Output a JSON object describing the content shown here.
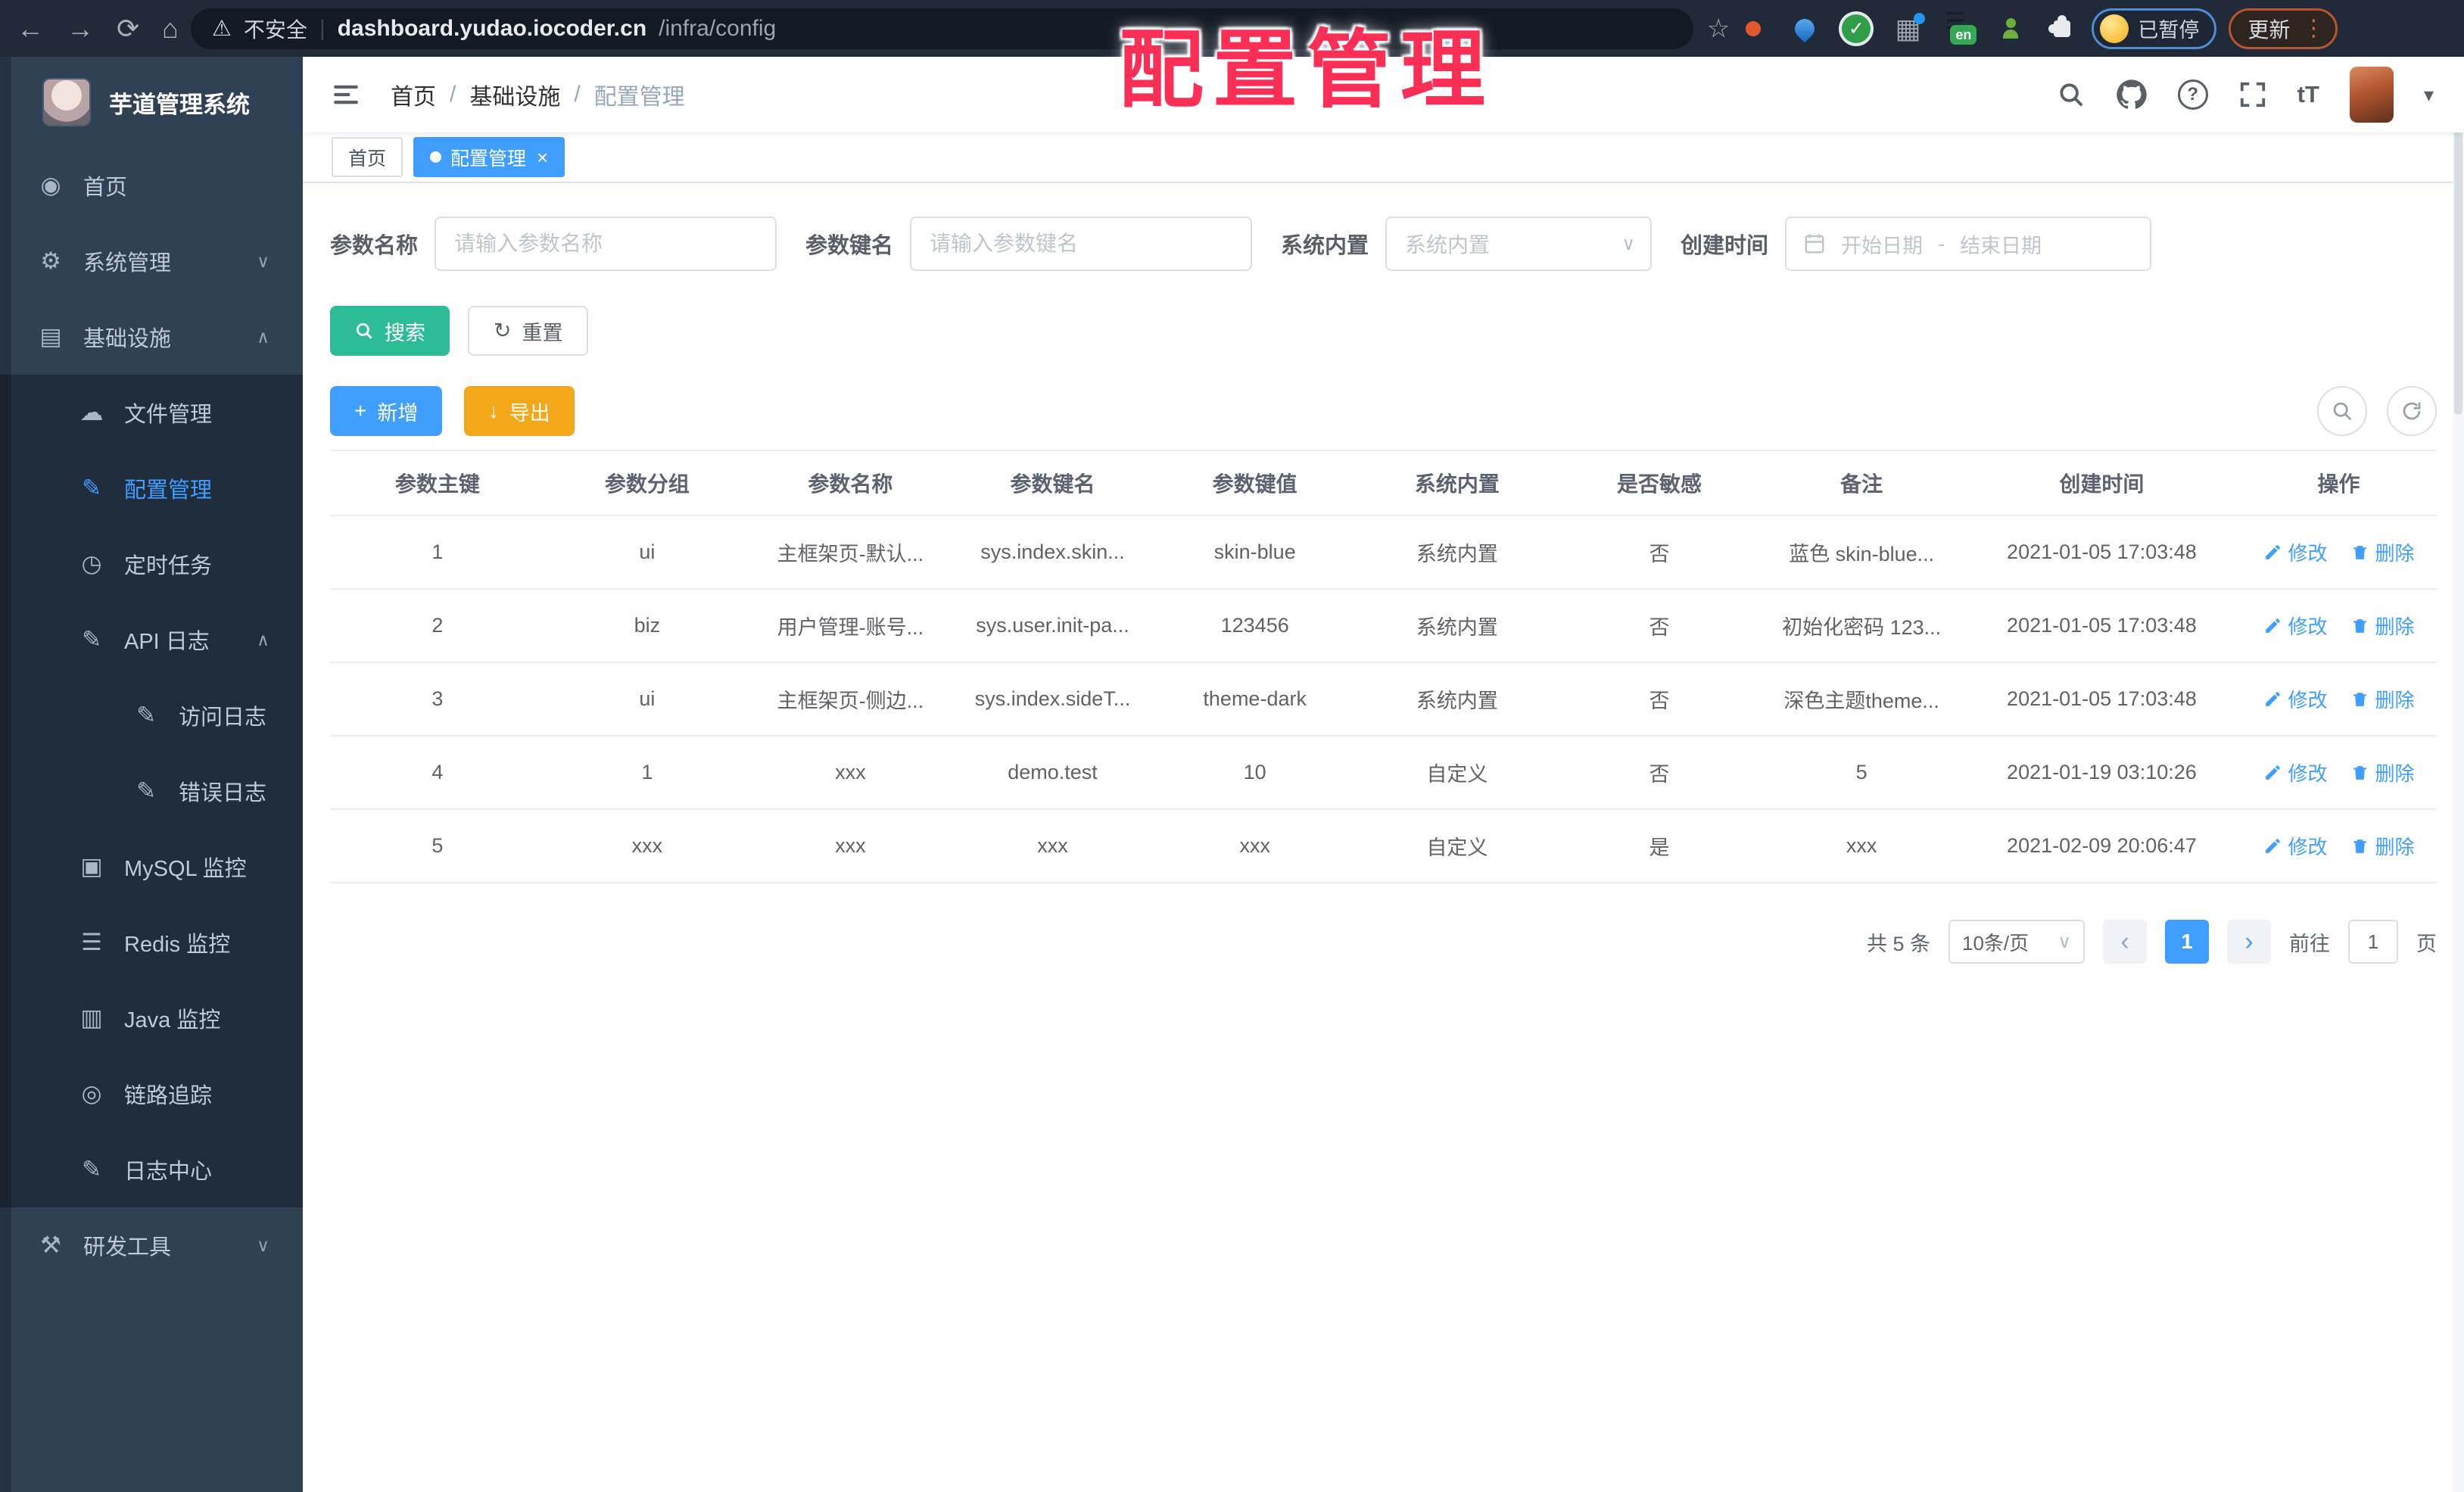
{
  "browser": {
    "security_label": "不安全",
    "url_host": "dashboard.yudao.iocoder.cn",
    "url_path": "/infra/config",
    "paused_label": "已暂停",
    "update_label": "更新"
  },
  "overlay_title": "配置管理",
  "icons": {
    "back": "←",
    "forward": "→",
    "reload": "⟳",
    "home": "⌂",
    "warning": "⚠",
    "star": "☆",
    "menu_dots": "⋮",
    "check": "✓",
    "grid": "▦",
    "stack_dark": "☰",
    "translate_badge": "en",
    "question": "?",
    "font_size": "tT",
    "close": "×",
    "select_caret": "∨",
    "user_caret": "▾",
    "divider": "|",
    "refresh": "↻",
    "plus": "+",
    "download": "↓",
    "prev": "‹",
    "next": "›",
    "range_sep": "-"
  },
  "sidebar": {
    "app_title": "芋道管理系统",
    "items": [
      {
        "label": "首页",
        "icon": "◉"
      },
      {
        "label": "系统管理",
        "icon": "⚙",
        "chevron": "∨"
      },
      {
        "label": "基础设施",
        "icon": "▤",
        "chevron": "∧"
      },
      {
        "label": "文件管理",
        "icon": "☁"
      },
      {
        "label": "配置管理",
        "icon": "✎"
      },
      {
        "label": "定时任务",
        "icon": "◷"
      },
      {
        "label": "API 日志",
        "icon": "✎",
        "chevron": "∧"
      },
      {
        "label": "访问日志",
        "icon": "✎"
      },
      {
        "label": "错误日志",
        "icon": "✎"
      },
      {
        "label": "MySQL 监控",
        "icon": "▣"
      },
      {
        "label": "Redis 监控",
        "icon": "☰"
      },
      {
        "label": "Java 监控",
        "icon": "▥"
      },
      {
        "label": "链路追踪",
        "icon": "◎"
      },
      {
        "label": "日志中心",
        "icon": "✎"
      },
      {
        "label": "研发工具",
        "icon": "⚒",
        "chevron": "∨"
      }
    ]
  },
  "header": {
    "breadcrumb": [
      "首页",
      "基础设施",
      "配置管理"
    ],
    "separator": "/"
  },
  "tags": {
    "home": "首页",
    "active": "配置管理"
  },
  "filters": {
    "name_label": "参数名称",
    "name_placeholder": "请输入参数名称",
    "key_label": "参数键名",
    "key_placeholder": "请输入参数键名",
    "type_label": "系统内置",
    "type_placeholder": "系统内置",
    "date_label": "创建时间",
    "date_start": "开始日期",
    "date_end": "结束日期"
  },
  "buttons": {
    "search": "搜索",
    "reset": "重置",
    "add": "新增",
    "export": "导出"
  },
  "table": {
    "columns": [
      "参数主键",
      "参数分组",
      "参数名称",
      "参数键名",
      "参数键值",
      "系统内置",
      "是否敏感",
      "备注",
      "创建时间",
      "操作"
    ],
    "ops": {
      "edit": "修改",
      "del": "删除"
    },
    "rows": [
      {
        "id": "1",
        "group": "ui",
        "name": "主框架页-默认...",
        "key": "sys.index.skin...",
        "value": "skin-blue",
        "type": "系统内置",
        "sensitive": "否",
        "remark": "蓝色 skin-blue...",
        "created": "2021-01-05 17:03:48"
      },
      {
        "id": "2",
        "group": "biz",
        "name": "用户管理-账号...",
        "key": "sys.user.init-pa...",
        "value": "123456",
        "type": "系统内置",
        "sensitive": "否",
        "remark": "初始化密码 123...",
        "created": "2021-01-05 17:03:48"
      },
      {
        "id": "3",
        "group": "ui",
        "name": "主框架页-侧边...",
        "key": "sys.index.sideT...",
        "value": "theme-dark",
        "type": "系统内置",
        "sensitive": "否",
        "remark": "深色主题theme...",
        "created": "2021-01-05 17:03:48"
      },
      {
        "id": "4",
        "group": "1",
        "name": "xxx",
        "key": "demo.test",
        "value": "10",
        "type": "自定义",
        "sensitive": "否",
        "remark": "5",
        "created": "2021-01-19 03:10:26"
      },
      {
        "id": "5",
        "group": "xxx",
        "name": "xxx",
        "key": "xxx",
        "value": "xxx",
        "type": "自定义",
        "sensitive": "是",
        "remark": "xxx",
        "created": "2021-02-09 20:06:47"
      }
    ]
  },
  "pagination": {
    "total": "共 5 条",
    "page_size": "10条/页",
    "current": "1",
    "goto_label": "前往",
    "goto_value": "1",
    "page_unit": "页"
  },
  "colors": {
    "accent": "#409eff",
    "search_button": "#2cbd96",
    "export_button": "#f3a819",
    "sidebar_bg": "#304156",
    "submenu_bg": "#1f2d3d",
    "tag_active": "#409eff",
    "overlay_title": "#fb2e55",
    "browser_bar": "#202a38"
  }
}
